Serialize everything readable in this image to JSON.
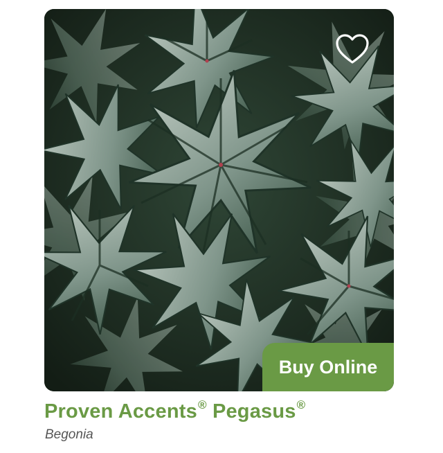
{
  "product": {
    "image_alt": "Begonia foliage",
    "name_part1": "Proven Accents",
    "name_mark1": "®",
    "name_part2": "Pegasus",
    "name_mark2": "®",
    "genus": "Begonia"
  },
  "actions": {
    "favorite_icon": "heart-outline-icon",
    "buy_label": "Buy Online"
  },
  "colors": {
    "brand_green": "#6a9a45",
    "subtitle_gray": "#555555"
  }
}
